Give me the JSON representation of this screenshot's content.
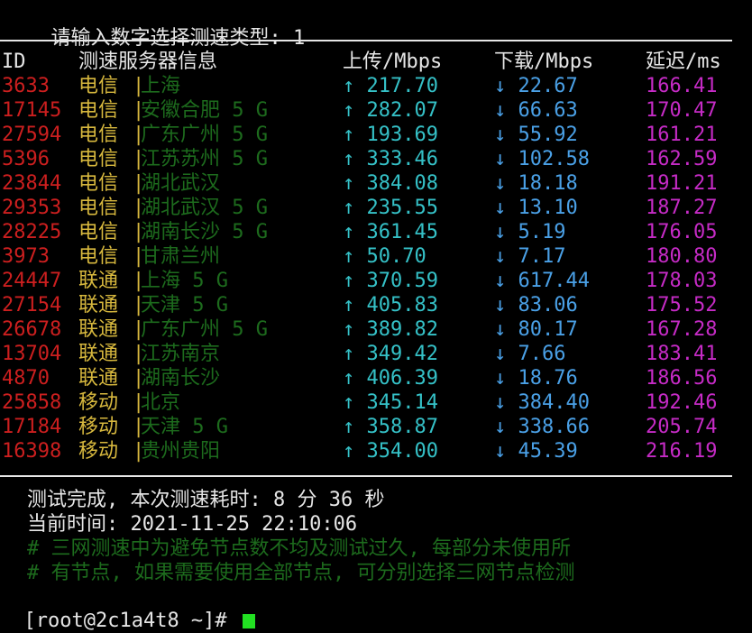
{
  "prompt": {
    "label": "请输入数字选择测速类型: ",
    "value": "1"
  },
  "table": {
    "headers": {
      "id": "ID",
      "server": "测速服务器信息",
      "upload": "上传/Mbps",
      "download": "下载/Mbps",
      "latency": "延迟/ms"
    },
    "rows": [
      {
        "id": "3633",
        "isp": "电信",
        "sep": "|",
        "loc": "上海",
        "up": "↑ 217.70",
        "down": "↓ 22.67",
        "lat": "166.41"
      },
      {
        "id": "17145",
        "isp": "电信",
        "sep": "|",
        "loc": "安徽合肥 5 G",
        "up": "↑ 282.07",
        "down": "↓ 66.63",
        "lat": "170.47"
      },
      {
        "id": "27594",
        "isp": "电信",
        "sep": "|",
        "loc": "广东广州 5 G",
        "up": "↑ 193.69",
        "down": "↓ 55.92",
        "lat": "161.21"
      },
      {
        "id": "5396",
        "isp": "电信",
        "sep": "|",
        "loc": "江苏苏州 5 G",
        "up": "↑ 333.46",
        "down": "↓ 102.58",
        "lat": "162.59"
      },
      {
        "id": "23844",
        "isp": "电信",
        "sep": "|",
        "loc": "湖北武汉",
        "up": "↑ 384.08",
        "down": "↓ 18.18",
        "lat": "191.21"
      },
      {
        "id": "29353",
        "isp": "电信",
        "sep": "|",
        "loc": "湖北武汉 5 G",
        "up": "↑ 235.55",
        "down": "↓ 13.10",
        "lat": "187.27"
      },
      {
        "id": "28225",
        "isp": "电信",
        "sep": "|",
        "loc": "湖南长沙 5 G",
        "up": "↑ 361.45",
        "down": "↓ 5.19",
        "lat": "176.05"
      },
      {
        "id": "3973",
        "isp": "电信",
        "sep": "|",
        "loc": "甘肃兰州",
        "up": "↑ 50.70",
        "down": "↓ 7.17",
        "lat": "180.80"
      },
      {
        "id": "24447",
        "isp": "联通",
        "sep": "|",
        "loc": "上海 5 G",
        "up": "↑ 370.59",
        "down": "↓ 617.44",
        "lat": "178.03"
      },
      {
        "id": "27154",
        "isp": "联通",
        "sep": "|",
        "loc": "天津 5 G",
        "up": "↑ 405.83",
        "down": "↓ 83.06",
        "lat": "175.52"
      },
      {
        "id": "26678",
        "isp": "联通",
        "sep": "|",
        "loc": "广东广州 5 G",
        "up": "↑ 389.82",
        "down": "↓ 80.17",
        "lat": "167.28"
      },
      {
        "id": "13704",
        "isp": "联通",
        "sep": "|",
        "loc": "江苏南京",
        "up": "↑ 349.42",
        "down": "↓ 7.66",
        "lat": "183.41"
      },
      {
        "id": "4870",
        "isp": "联通",
        "sep": "|",
        "loc": "湖南长沙",
        "up": "↑ 406.39",
        "down": "↓ 18.76",
        "lat": "186.56"
      },
      {
        "id": "25858",
        "isp": "移动",
        "sep": "|",
        "loc": "北京",
        "up": "↑ 345.14",
        "down": "↓ 384.40",
        "lat": "192.46"
      },
      {
        "id": "17184",
        "isp": "移动",
        "sep": "|",
        "loc": "天津 5 G",
        "up": "↑ 358.87",
        "down": "↓ 338.66",
        "lat": "205.74"
      },
      {
        "id": "16398",
        "isp": "移动",
        "sep": "|",
        "loc": "贵州贵阳",
        "up": "↑ 354.00",
        "down": "↓ 45.39",
        "lat": "216.19"
      }
    ]
  },
  "summary": {
    "complete": "测试完成, 本次测速耗时: 8 分 36 秒",
    "time": "当前时间: 2021-11-25 22:10:06",
    "note1": "# 三网测速中为避免节点数不均及测试过久, 每部分未使用所",
    "note2": "# 有节点, 如果需要使用全部节点, 可分别选择三网节点检测"
  },
  "shell": {
    "prompt": "[root@2c1a4t8 ~]# "
  },
  "colors": {
    "background": "#000000",
    "id": "#cc1f1f",
    "isp": "#d7b83e",
    "location": "#1d6b1d",
    "upload": "#35c1c7",
    "download": "#4aa0e6",
    "latency": "#c62bc6",
    "cursor": "#22e022"
  }
}
